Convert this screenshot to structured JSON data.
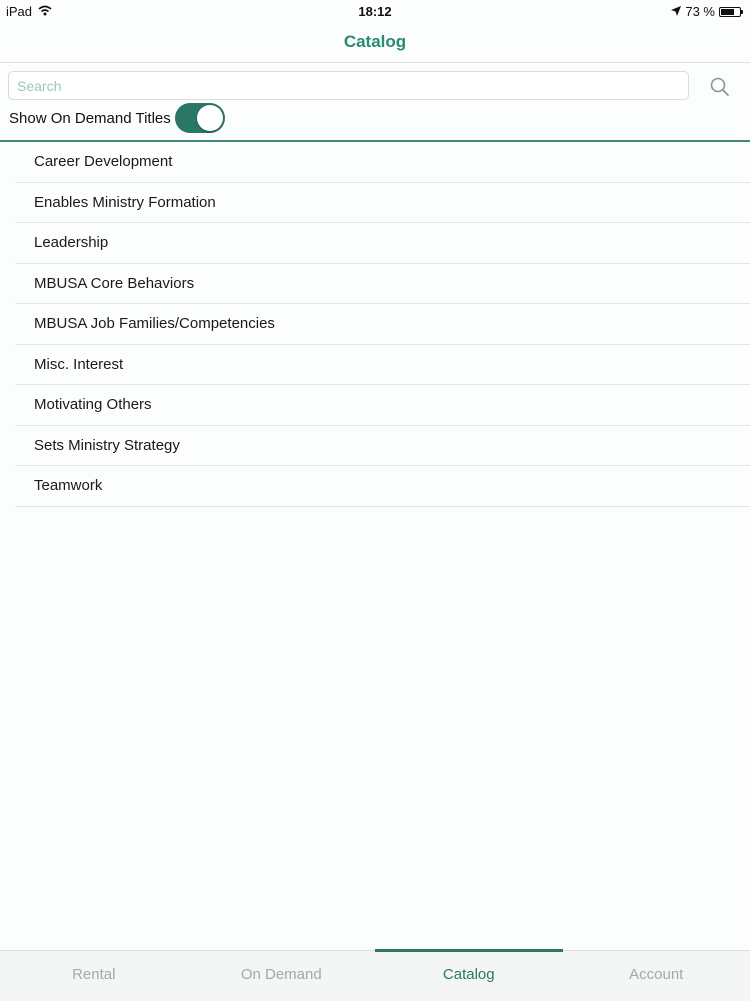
{
  "status_bar": {
    "device": "iPad",
    "time": "18:12",
    "battery_text": "73 %",
    "battery_level": 0.73
  },
  "nav": {
    "title": "Catalog"
  },
  "search": {
    "placeholder": "Search",
    "value": ""
  },
  "toggle": {
    "label": "Show On Demand Titles",
    "on": true
  },
  "categories": [
    "Career Development",
    "Enables Ministry Formation",
    "Leadership",
    "MBUSA Core Behaviors",
    "MBUSA Job Families/Competencies",
    "Misc. Interest",
    "Motivating Others",
    "Sets Ministry Strategy",
    "Teamwork"
  ],
  "tabs": [
    {
      "label": "Rental",
      "active": false
    },
    {
      "label": "On Demand",
      "active": false
    },
    {
      "label": "Catalog",
      "active": true
    },
    {
      "label": "Account",
      "active": false
    }
  ],
  "colors": {
    "accent": "#2a7767",
    "title": "#2a8a73"
  },
  "icons": [
    "wifi-icon",
    "location-arrow-icon",
    "battery-icon",
    "search-icon"
  ]
}
